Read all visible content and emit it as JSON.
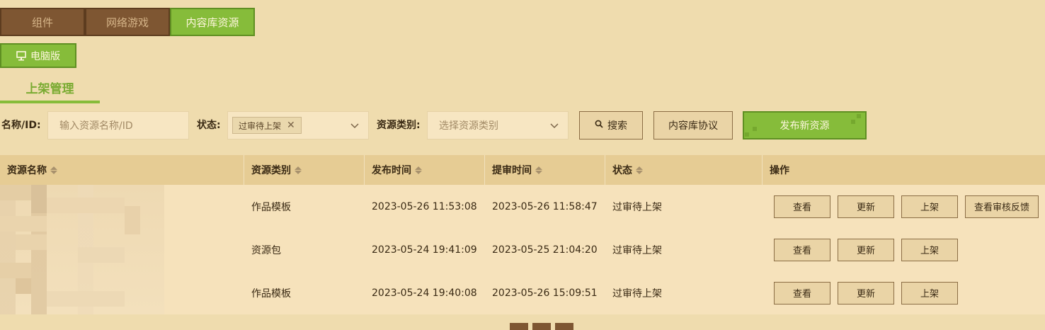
{
  "tabs": [
    "组件",
    "网络游戏",
    "内容库资源"
  ],
  "platform": {
    "label": "电脑版"
  },
  "section": {
    "title": "上架管理"
  },
  "filters": {
    "name_label": "名称/ID:",
    "name_placeholder": "输入资源名称/ID",
    "status_label": "状态:",
    "status_tag": "过审待上架",
    "category_label": "资源类别:",
    "category_placeholder": "选择资源类别",
    "search_label": "搜索",
    "agreement_label": "内容库协议",
    "publish_label": "发布新资源"
  },
  "table": {
    "headers": [
      "资源名称",
      "资源类别",
      "发布时间",
      "提审时间",
      "状态",
      "操作"
    ],
    "rows": [
      {
        "category": "作品模板",
        "publish": "2023-05-26 11:53:08",
        "review": "2023-05-26 11:58:47",
        "status": "过审待上架",
        "ops": [
          "查看",
          "更新",
          "上架",
          "查看审核反馈"
        ]
      },
      {
        "category": "资源包",
        "publish": "2023-05-24 19:41:09",
        "review": "2023-05-25 21:04:20",
        "status": "过审待上架",
        "ops": [
          "查看",
          "更新",
          "上架"
        ]
      },
      {
        "category": "作品模板",
        "publish": "2023-05-24 19:40:08",
        "review": "2023-05-26 15:09:51",
        "status": "过审待上架",
        "ops": [
          "查看",
          "更新",
          "上架"
        ]
      }
    ]
  },
  "colors": {
    "accent": "#86bc3a",
    "tab_dark": "#7e5632",
    "background": "#efdcae"
  }
}
